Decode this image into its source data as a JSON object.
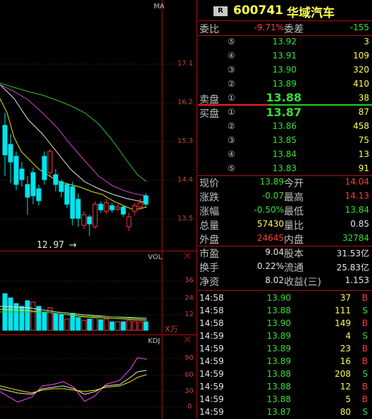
{
  "stock": {
    "r_badge": "R",
    "code": "600741",
    "name": "华域汽车"
  },
  "commission": {
    "ratio_label": "委比",
    "ratio": "-9.71%",
    "diff_label": "委差",
    "diff": "-155"
  },
  "sell_label": "卖盘",
  "buy_label": "买盘",
  "asks": [
    {
      "idx": "⑤",
      "price": "13.92",
      "vol": "3"
    },
    {
      "idx": "④",
      "price": "13.91",
      "vol": "109"
    },
    {
      "idx": "③",
      "price": "13.90",
      "vol": "320"
    },
    {
      "idx": "②",
      "price": "13.89",
      "vol": "410"
    },
    {
      "idx": "①",
      "price": "13.88",
      "vol": "38"
    }
  ],
  "bids": [
    {
      "idx": "①",
      "price": "13.87",
      "vol": "87"
    },
    {
      "idx": "②",
      "price": "13.86",
      "vol": "458"
    },
    {
      "idx": "③",
      "price": "13.85",
      "vol": "75"
    },
    {
      "idx": "④",
      "price": "13.84",
      "vol": "13"
    },
    {
      "idx": "⑤",
      "price": "13.83",
      "vol": "91"
    }
  ],
  "quote": [
    {
      "l1": "现价",
      "v1": "13.89",
      "l2": "今开",
      "v2": "14.04"
    },
    {
      "l1": "涨跌",
      "v1": "-0.07",
      "l2": "最高",
      "v2": "14.13"
    },
    {
      "l1": "涨幅",
      "v1": "-0.50%",
      "l2": "最低",
      "v2": "13.84"
    },
    {
      "l1": "总量",
      "v1": "57430",
      "l2": "量比",
      "v2": "0.85"
    },
    {
      "l1": "外盘",
      "v1": "24645",
      "l2": "内盘",
      "v2": "32784"
    }
  ],
  "fundamentals": [
    {
      "l1": "市盈",
      "v1": "9.04",
      "l2": "股本",
      "v2": "31.53亿"
    },
    {
      "l1": "换手",
      "v1": "0.22%",
      "l2": "流通",
      "v2": "25.83亿"
    },
    {
      "l1": "净资",
      "v1": "8.02",
      "l2": "收益(三)",
      "v2": "1.153"
    }
  ],
  "ticks": [
    {
      "time": "14:58",
      "price": "13.90",
      "vol": "37",
      "side": "B"
    },
    {
      "time": "14:58",
      "price": "13.88",
      "vol": "111",
      "side": "S"
    },
    {
      "time": "14:58",
      "price": "13.90",
      "vol": "149",
      "side": "B"
    },
    {
      "time": "14:59",
      "price": "13.89",
      "vol": "4",
      "side": "S"
    },
    {
      "time": "14:59",
      "price": "13.89",
      "vol": "23",
      "side": "B"
    },
    {
      "time": "14:59",
      "price": "13.89",
      "vol": "16",
      "side": "B"
    },
    {
      "time": "14:59",
      "price": "13.88",
      "vol": "208",
      "side": "S"
    },
    {
      "time": "14:59",
      "price": "13.88",
      "vol": "12",
      "side": "B"
    },
    {
      "time": "14:59",
      "price": "13.88",
      "vol": "5",
      "side": "B"
    },
    {
      "time": "14:59",
      "price": "13.87",
      "vol": "80",
      "side": "S"
    }
  ],
  "price_chart": {
    "indicator_label": "MA",
    "axis_ticks": [
      "17.1",
      "16.2",
      "15.3",
      "14.4",
      "13.5"
    ],
    "low_marker": "12.97"
  },
  "vol_chart": {
    "label": "VOL",
    "axis_ticks": [
      "36",
      "24",
      "12"
    ],
    "unit": "X万"
  },
  "kdj_chart": {
    "label": "KDJ",
    "axis_ticks": [
      "90",
      "60",
      "30",
      "0"
    ]
  },
  "colors": {
    "up": "#ff3b3b",
    "down": "#35e035",
    "cyan": "#00e5ee",
    "yellow": "#ffff4c",
    "border": "#b01010"
  }
}
